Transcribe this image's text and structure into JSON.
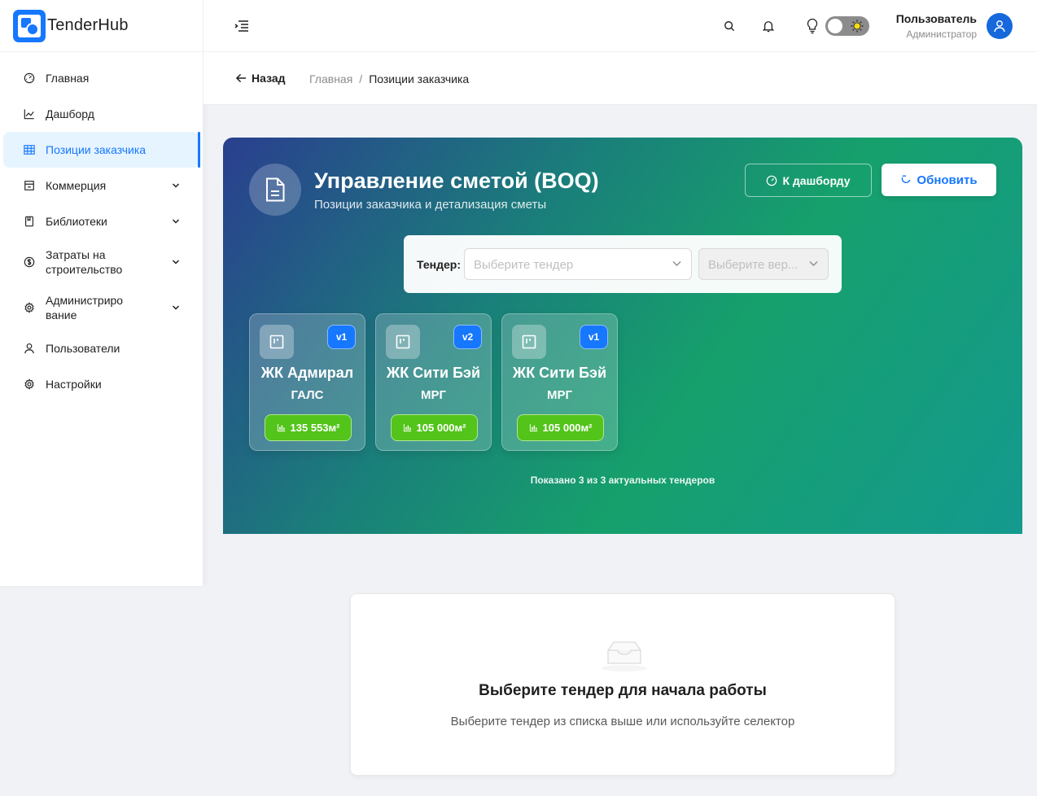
{
  "app": {
    "name": "TenderHub"
  },
  "sidebar": {
    "items": [
      {
        "label": "Главная",
        "icon": "dashboard-gauge-icon"
      },
      {
        "label": "Дашборд",
        "icon": "line-chart-icon"
      },
      {
        "label": "Позиции заказчика",
        "icon": "table-icon",
        "active": true
      },
      {
        "label": "Коммерция",
        "icon": "shop-icon",
        "expandable": true
      },
      {
        "label": "Библиотеки",
        "icon": "book-icon",
        "expandable": true
      },
      {
        "label": "Затраты на строительство",
        "line1": "Затраты на",
        "line2": "строительство",
        "icon": "dollar-icon",
        "expandable": true
      },
      {
        "label": "Администрирование",
        "line1": "Администриро",
        "line2": "вание",
        "icon": "settings-icon",
        "expandable": true
      },
      {
        "label": "Пользователи",
        "icon": "user-icon"
      },
      {
        "label": "Настройки",
        "icon": "settings-icon"
      }
    ]
  },
  "header": {
    "user_name": "Пользователь",
    "user_role": "Администратор"
  },
  "breadcrumb": {
    "back_label": "Назад",
    "items": [
      "Главная",
      "Позиции заказчика"
    ],
    "separator": "/"
  },
  "hero": {
    "title": "Управление сметой (BOQ)",
    "subtitle": "Позиции заказчика и детализация сметы",
    "dashboard_button": "К дашборду",
    "refresh_button": "Обновить",
    "tender_label": "Тендер:",
    "tender_placeholder": "Выберите тендер",
    "version_placeholder": "Выберите вер...",
    "shown_text": "Показано 3 из 3 актуальных тендеров"
  },
  "tender_cards": [
    {
      "name": "ЖК Адмирал",
      "sub": "ГАЛС",
      "version": "v1",
      "area": "135 553м²"
    },
    {
      "name": "ЖК Сити Бэй",
      "sub": "МРГ",
      "version": "v2",
      "area": "105 000м²"
    },
    {
      "name": "ЖК Сити Бэй",
      "sub": "МРГ",
      "version": "v1",
      "area": "105 000м²"
    }
  ],
  "empty_state": {
    "title": "Выберите тендер для начала работы",
    "description": "Выберите тендер из списка выше или используйте селектор"
  },
  "colors": {
    "primary": "#1677ff",
    "success": "#52c41a",
    "hero_gradient_start": "#2a3f8f",
    "hero_gradient_end": "#149a8f"
  }
}
